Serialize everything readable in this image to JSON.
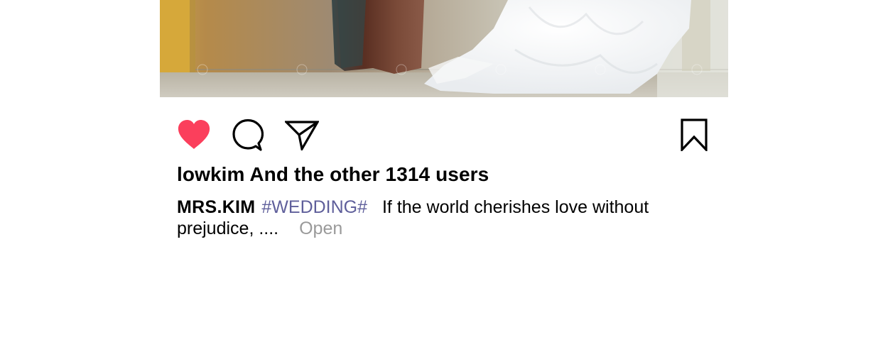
{
  "post": {
    "image_alt": "wedding dress photo",
    "likes_text": "lowkim And the other 1314 users",
    "caption": {
      "username": "MRS.KIM",
      "hashtag": "#WEDDING#",
      "text": "If the world cherishes love without prejudice, ....",
      "more_label": "Open"
    }
  },
  "icons": {
    "like": "heart-icon",
    "comment": "speech-bubble-icon",
    "share": "paper-plane-icon",
    "save": "bookmark-icon"
  },
  "colors": {
    "like_active": "#fb3f5c",
    "hashtag": "#5f5f9b",
    "more_link": "#9a9a9a"
  }
}
